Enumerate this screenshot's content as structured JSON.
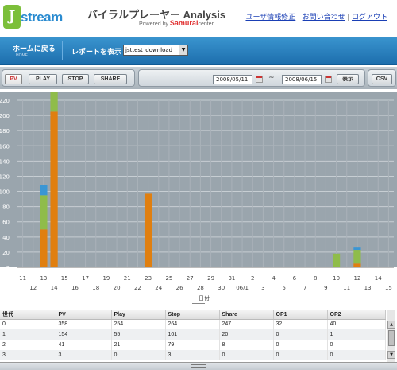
{
  "header": {
    "logo_mark": "J",
    "logo_text": "stream",
    "app_title": "バイラルプレーヤー Analysis",
    "powered_prefix": "Powered by",
    "powered_brand": "Samurai",
    "powered_suffix": "center",
    "links": [
      "ユーザ情報修正",
      "お問い合わせ",
      "ログアウト"
    ]
  },
  "nav": {
    "home_label": "ホームに戻る",
    "home_sub": "HOME",
    "report_label": "レポートを表示",
    "report_select": "jsttest_download"
  },
  "toolbar": {
    "buttons": [
      "PV",
      "PLAY",
      "STOP",
      "SHARE"
    ],
    "date_from": "2008/05/11",
    "tilde": "~",
    "date_to": "2008/06/15",
    "show_label": "表示",
    "csv_label": "CSV"
  },
  "chart_data": {
    "type": "bar",
    "stacked": true,
    "xlabel": "日付",
    "ylim": [
      0,
      220
    ],
    "yticks": [
      0,
      20,
      40,
      60,
      80,
      100,
      120,
      140,
      160,
      180,
      200,
      220
    ],
    "xticks_top": [
      "11",
      "13",
      "15",
      "17",
      "19",
      "21",
      "23",
      "25",
      "27",
      "29",
      "31",
      "2",
      "4",
      "6",
      "8",
      "10",
      "12",
      "14"
    ],
    "xticks_bottom": [
      "12",
      "14",
      "16",
      "18",
      "20",
      "22",
      "24",
      "26",
      "28",
      "30",
      "06/1",
      "3",
      "5",
      "7",
      "9",
      "11",
      "13",
      "15"
    ],
    "colors": [
      "#e07f10",
      "#8fbc4a",
      "#3a96d4"
    ],
    "bars": [
      {
        "day": "13",
        "values": [
          50,
          45,
          13
        ]
      },
      {
        "day": "14",
        "values": [
          205,
          55,
          20
        ]
      },
      {
        "day": "23",
        "values": [
          97,
          0,
          0
        ]
      },
      {
        "day": "10",
        "values": [
          0,
          18,
          0
        ]
      },
      {
        "day": "12",
        "values": [
          5,
          18,
          3
        ]
      }
    ]
  },
  "table": {
    "columns": [
      "世代",
      "PV",
      "Play",
      "Stop",
      "Share",
      "OP1",
      "OP2"
    ],
    "rows": [
      [
        "0",
        "358",
        "254",
        "264",
        "247",
        "32",
        "40"
      ],
      [
        "1",
        "154",
        "55",
        "101",
        "20",
        "0",
        "1"
      ],
      [
        "2",
        "41",
        "21",
        "79",
        "8",
        "0",
        "0"
      ],
      [
        "3",
        "3",
        "0",
        "3",
        "0",
        "0",
        "0"
      ]
    ]
  }
}
